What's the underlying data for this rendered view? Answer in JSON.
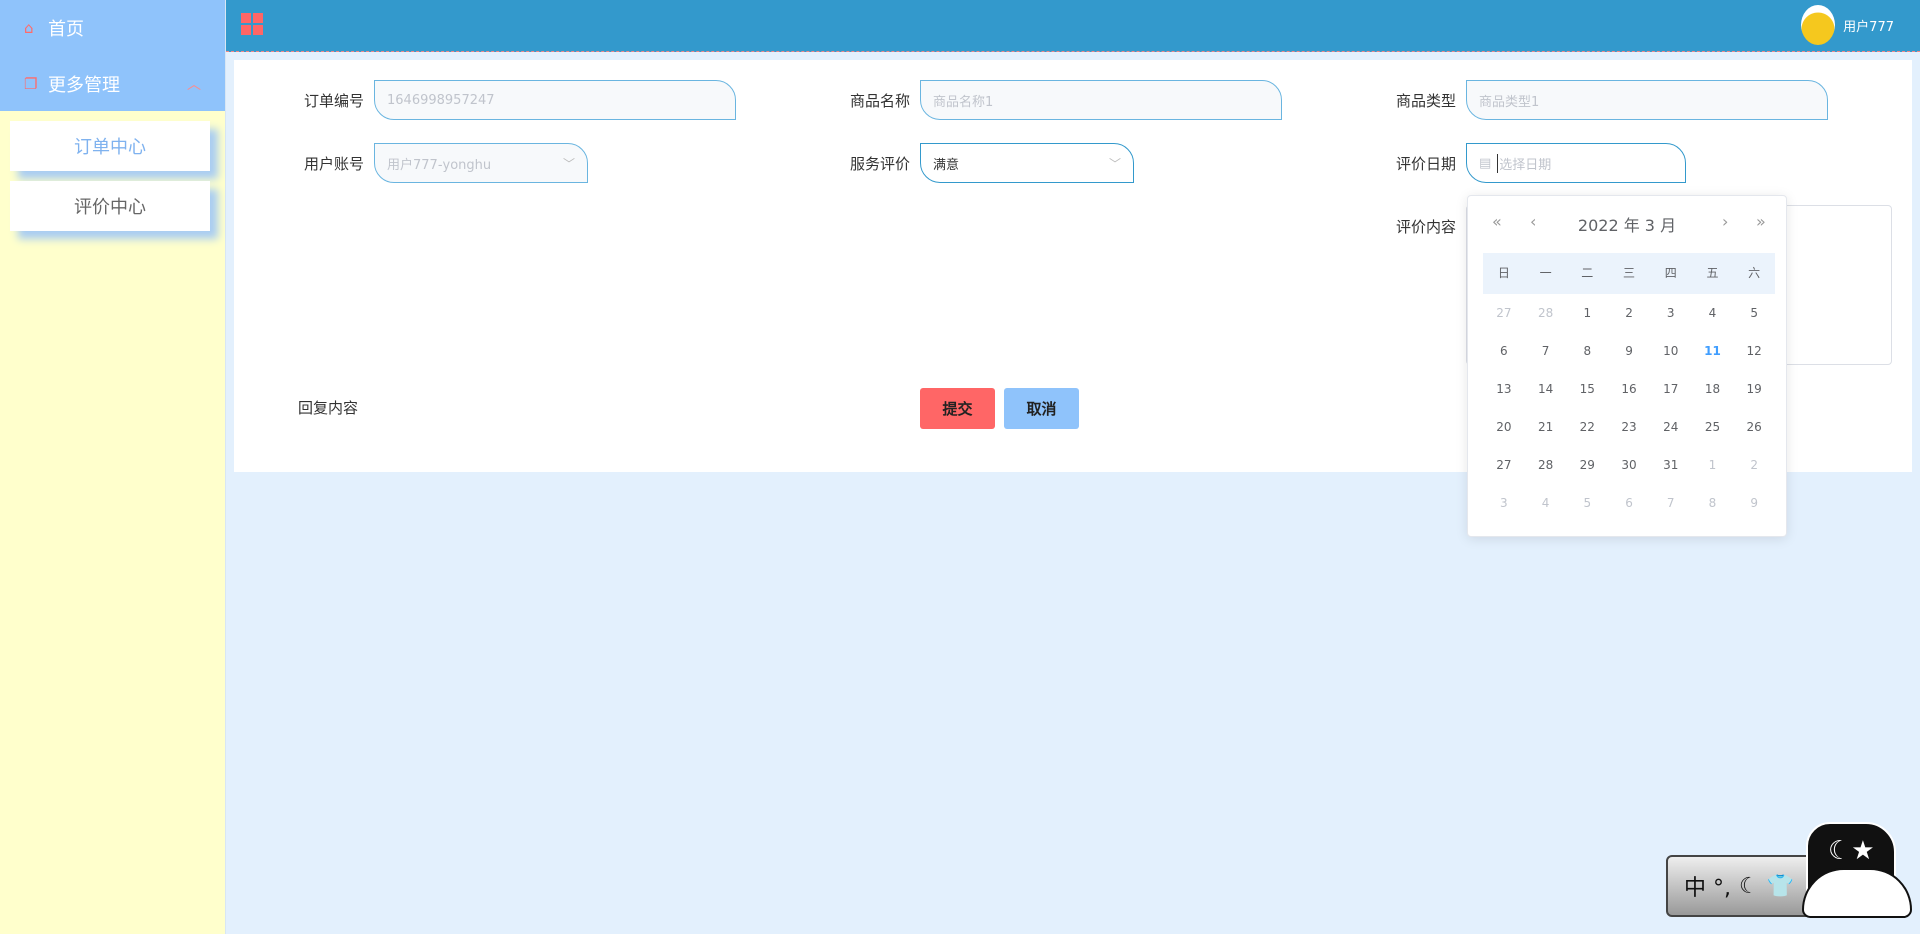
{
  "sidebar": {
    "home": "首页",
    "more": "更多管理",
    "subitems": [
      {
        "label": "订单中心",
        "active": true
      },
      {
        "label": "评价中心",
        "active": false
      }
    ]
  },
  "header": {
    "username": "用户777"
  },
  "form": {
    "order_no": {
      "label": "订单编号",
      "value": "1646998957247"
    },
    "product_name": {
      "label": "商品名称",
      "value": "商品名称1"
    },
    "product_type": {
      "label": "商品类型",
      "value": "商品类型1"
    },
    "user_account": {
      "label": "用户账号",
      "value": "用户777-yonghu"
    },
    "service_rating": {
      "label": "服务评价",
      "value": "满意"
    },
    "review_date": {
      "label": "评价日期",
      "placeholder": "选择日期"
    },
    "review_content": {
      "label": "评价内容"
    },
    "reply_content": {
      "label": "回复内容"
    },
    "submit": "提交",
    "cancel": "取消"
  },
  "calendar": {
    "title": "2022 年  3 月",
    "weekdays": [
      "日",
      "一",
      "二",
      "三",
      "四",
      "五",
      "六"
    ],
    "weeks": [
      [
        "27",
        "28",
        "1",
        "2",
        "3",
        "4",
        "5"
      ],
      [
        "6",
        "7",
        "8",
        "9",
        "10",
        "11",
        "12"
      ],
      [
        "13",
        "14",
        "15",
        "16",
        "17",
        "18",
        "19"
      ],
      [
        "20",
        "21",
        "22",
        "23",
        "24",
        "25",
        "26"
      ],
      [
        "27",
        "28",
        "29",
        "30",
        "31",
        "1",
        "2"
      ],
      [
        "3",
        "4",
        "5",
        "6",
        "7",
        "8",
        "9"
      ]
    ],
    "today": "11"
  },
  "ime": {
    "text": "中 °,"
  },
  "colors": {
    "header": "#3399cc",
    "menu": "#8fc3fb",
    "submit": "#ff6666",
    "cancel": "#8fc3fb",
    "accent": "#409eff"
  }
}
